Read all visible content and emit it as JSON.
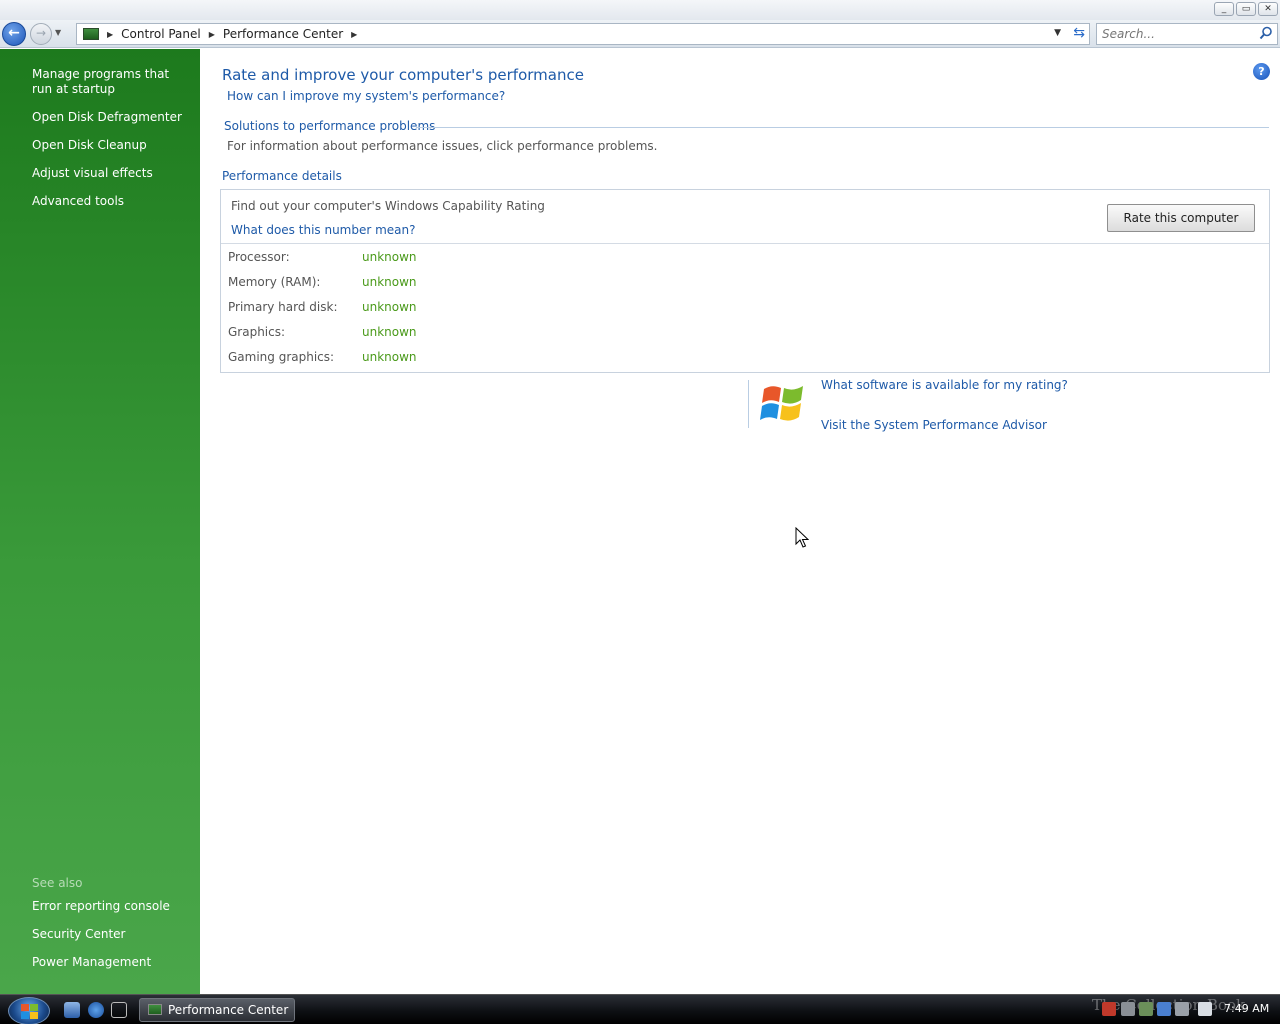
{
  "caption": {
    "minimize": "_",
    "maximize": "▭",
    "close": "✕"
  },
  "address": {
    "breadcrumbs": [
      "Control Panel",
      "Performance Center"
    ]
  },
  "search": {
    "placeholder": "Search..."
  },
  "sidebar": {
    "tasks": [
      "Manage programs that run at startup",
      "Open Disk Defragmenter",
      "Open Disk Cleanup",
      "Adjust visual effects",
      "Advanced tools"
    ],
    "see_also_heading": "See also",
    "see_also": [
      "Error reporting console",
      "Security Center",
      "Power Management"
    ]
  },
  "main": {
    "title": "Rate and improve your computer's performance",
    "improve_link": "How can I improve my system's performance?",
    "solutions_heading": "Solutions to performance problems",
    "solutions_text": "For information about performance issues, click performance problems.",
    "details_heading": "Performance details",
    "capability_text": "Find out your computer's Windows Capability Rating",
    "number_link": "What does this number mean?",
    "rate_button": "Rate this computer",
    "ratings": [
      {
        "label": "Processor:",
        "value": "unknown"
      },
      {
        "label": "Memory (RAM):",
        "value": "unknown"
      },
      {
        "label": "Primary hard disk:",
        "value": "unknown"
      },
      {
        "label": "Graphics:",
        "value": "unknown"
      },
      {
        "label": "Gaming graphics:",
        "value": "unknown"
      }
    ],
    "software_link": "What software is available for my rating?",
    "advisor_link": "Visit the System Performance Advisor",
    "help_glyph": "?"
  },
  "taskbar": {
    "window_button": "Performance Center",
    "watermark": "The Collection Book",
    "clock": "7:49 AM"
  },
  "colors": {
    "sidebar": "#2f8f2f",
    "link": "#1e5aa8",
    "value_green": "#4a9a1a"
  }
}
